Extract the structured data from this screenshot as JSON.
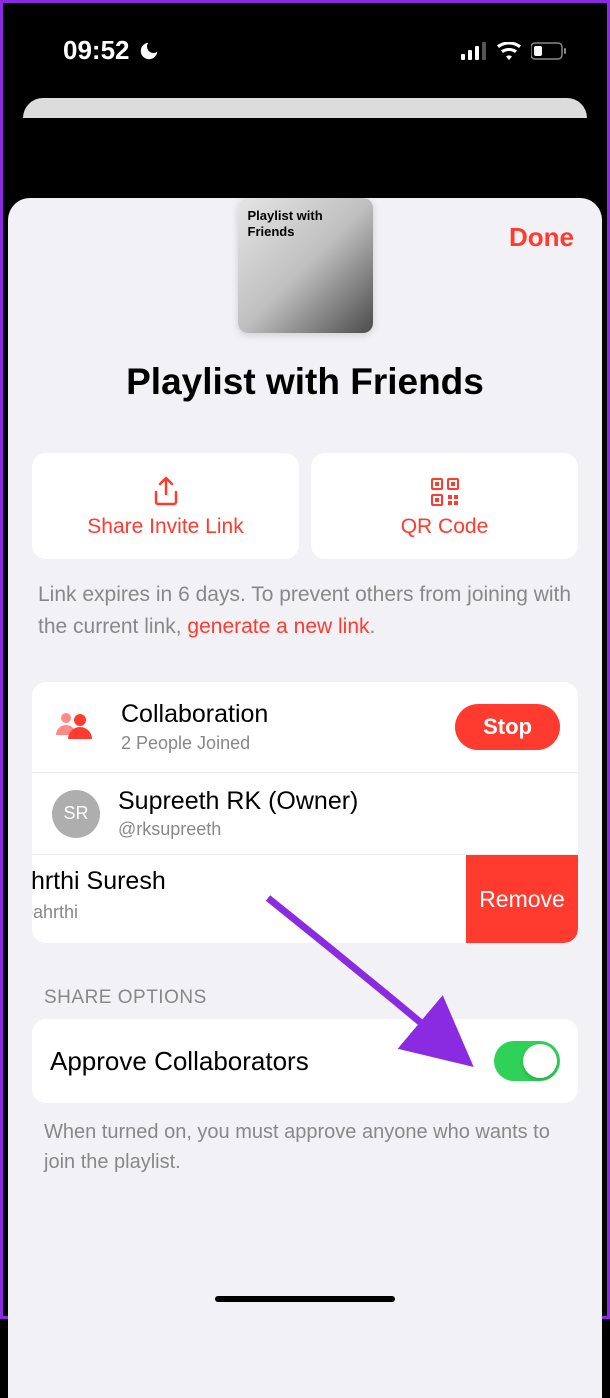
{
  "status": {
    "time": "09:52"
  },
  "done_label": "Done",
  "cover_label": "Playlist with Friends",
  "playlist_title": "Playlist with Friends",
  "actions": {
    "share": "Share Invite Link",
    "qr": "QR Code"
  },
  "expire": {
    "text_a": "Link expires in 6 days. To prevent others from joining with the current link, ",
    "link": "generate a new link",
    "text_b": "."
  },
  "collab": {
    "title": "Collaboration",
    "subtitle": "2 People Joined",
    "stop": "Stop"
  },
  "owner": {
    "initials": "SR",
    "name": "Supreeth RK (Owner)",
    "handle": "@rksupreeth"
  },
  "member": {
    "name_partial": "ıhrthi Suresh",
    "handle_partial": "ɔahrthi"
  },
  "remove_label": "Remove",
  "share_options": {
    "header": "SHARE OPTIONS",
    "approve": "Approve Collaborators",
    "approve_sub": "When turned on, you must approve anyone who wants to join the playlist."
  }
}
